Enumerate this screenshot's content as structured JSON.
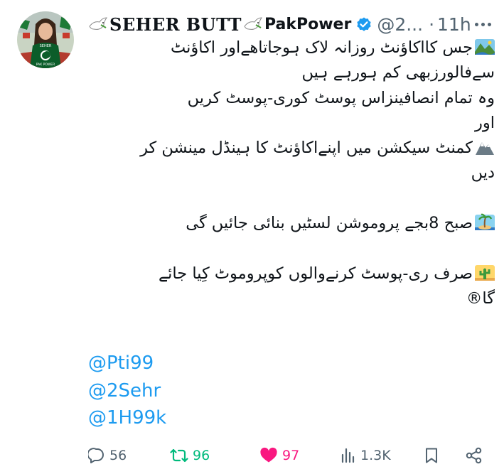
{
  "author": {
    "name": "SEHER BUTT",
    "suffix": "PakPower",
    "handle": "@2...",
    "time": "11h",
    "verified": true,
    "avatar": {
      "shirt_text": "PAK POWER",
      "badge": "SEHER"
    }
  },
  "body_lines": [
    {
      "text": "جس کااکاؤنٹ روزانہ لاک ہوجاتاھےاور اکاؤنٹ",
      "emoji": "national-park-icon"
    },
    {
      "text": "سےفالورزبھی کم ہورہے ہیں"
    },
    {
      "text": "وہ تمام انصافینزاس پوسٹ کوری-پوسٹ کریں"
    },
    {
      "text": "اور"
    },
    {
      "text": "کمنٹ سیکشن میں اپنےاکاؤنٹ کا ہینڈل مینشن کر",
      "emoji": "mountain-icon"
    },
    {
      "text": "دیں"
    },
    {
      "text": ""
    },
    {
      "text": "صبح 8بجے پروموشن لسٹیں بنائی جائیں گی",
      "emoji": "desert-island-icon"
    },
    {
      "text": ""
    },
    {
      "text": "صرف ری-پوسٹ کرنےوالوں کوپروموٹ کِیا جائے",
      "emoji": "desert-cactus-icon"
    },
    {
      "text": "گا®"
    }
  ],
  "mentions": [
    "@Pti99",
    "@2Sehr",
    "@1H99k"
  ],
  "actions": {
    "replies": "56",
    "reposts": "96",
    "likes": "97",
    "views": "1.3K"
  },
  "colors": {
    "link": "#1d9bf0",
    "muted": "#536471",
    "repost": "#00ba7c",
    "like": "#f91880",
    "verified": "#1d9bf0"
  }
}
